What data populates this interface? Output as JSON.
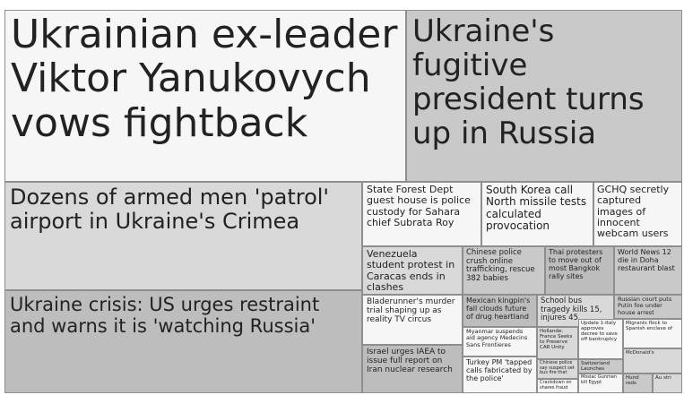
{
  "headlines": {
    "h1": "Ukrainian ex-leader Viktor Yanukovych vows fightback",
    "h2": "Ukraine's fugitive president turns up in Russia",
    "h3": "Dozens of armed men 'patrol' airport in Ukraine's Crimea",
    "h4": "Ukraine crisis: US urges restraint and warns it is 'watching Russia'",
    "h5": "State Forest Dept guest house is police custody for Sahara chief Subrata Roy",
    "h6": "South Korea call North missile tests calculated provocation",
    "h7": "GCHQ secretly captured images of innocent webcam users",
    "h8": "Venezuela student protest in Caracas ends in clashes",
    "h9": "Chinese police crush online trafficking, rescue 382 babies",
    "h10": "Thai protesters to move out of most Bangkok rally sites",
    "h11": "World News 12 die in Doha restaurant blast",
    "h12": "Bladerunner's murder trial shaping up as reality TV circus",
    "h13": "Mexican kingpin's fall clouds future of drug heartland",
    "h14": "School bus tragedy kills 15, injures 45",
    "h15": "Russian court puts Putin foe under house arrest",
    "h16": "Myanmar suspends aid agency Medecins Sans Frontieres",
    "h17": "Hollande: France Seeks to Preserve CAR Unity",
    "h18": "Update 1-Italy approves decree to save off bankruptcy",
    "h19": "Migrants flock to Spanish enclave of",
    "h20": "Israel urges IAEA to issue full report on Iran nuclear research",
    "h21": "Turkey PM 'tapped calls fabricated by the police'",
    "h22": "Chinese police say suspect set bus fire that",
    "h23": "Switzerland Launches",
    "h24": "McDonald's",
    "h25": "Crackdown on shares fraud",
    "h26": "Mosiac Gunmen kill Egypt",
    "h27": "Hund reds",
    "h28": "Au stri"
  }
}
